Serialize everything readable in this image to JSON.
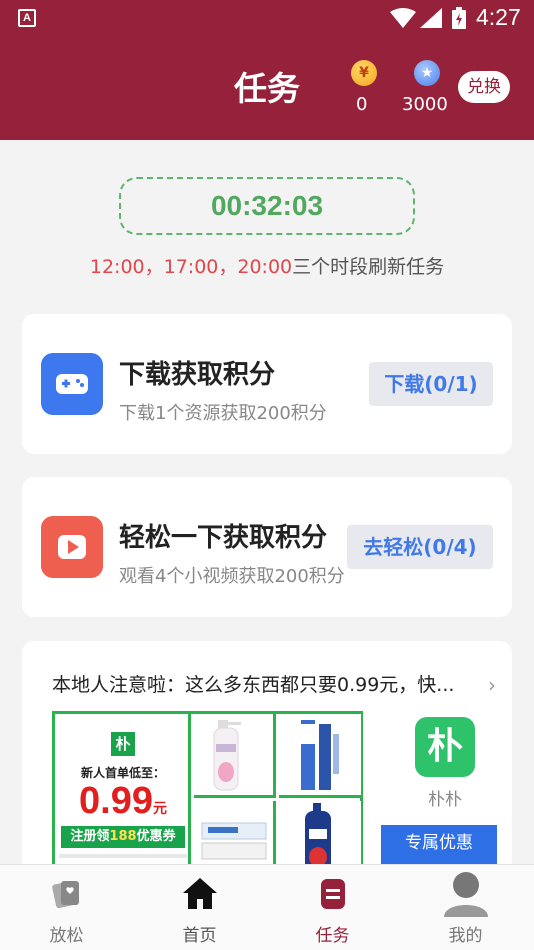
{
  "status_bar": {
    "time": "4:27",
    "app_icon_letter": "A"
  },
  "header": {
    "title": "任务",
    "gold_coin_symbol": "¥",
    "gold_count": "0",
    "blue_count": "3000",
    "exchange_label": "兑换",
    "brand_color": "#95223a"
  },
  "timer": {
    "countdown": "00:32:03",
    "note_times": "12:00，17:00，20:00",
    "note_suffix": "三个时段刷新任务"
  },
  "tasks": [
    {
      "title": "下载获取积分",
      "subtitle": "下载1个资源获取200积分",
      "button": "下载(0/1)",
      "icon": "gamepad-icon",
      "color": "#3d78ee"
    },
    {
      "title": "轻松一下获取积分",
      "subtitle": "观看4个小视频获取200积分",
      "button": "去轻松(0/4)",
      "icon": "play-icon",
      "color": "#ee5f4f"
    }
  ],
  "ad": {
    "headline": "本地人注意啦：这么多东西都只要0.99元，快...",
    "arrow": "›",
    "small_logo": "朴",
    "promo_line": "新人首单低至：",
    "price": "0.99",
    "price_unit": "元",
    "coupon_prefix": "注册领",
    "coupon_amount": "188",
    "coupon_suffix": "优惠券",
    "brand_logo": "朴",
    "brand_name": "朴朴",
    "cta": "专属优惠"
  },
  "tabbar": {
    "items": [
      {
        "label": "放松",
        "icon": "cards-icon"
      },
      {
        "label": "首页",
        "icon": "home-icon"
      },
      {
        "label": "任务",
        "icon": "task-icon",
        "active": true
      },
      {
        "label": "我的",
        "icon": "profile-icon"
      }
    ]
  }
}
